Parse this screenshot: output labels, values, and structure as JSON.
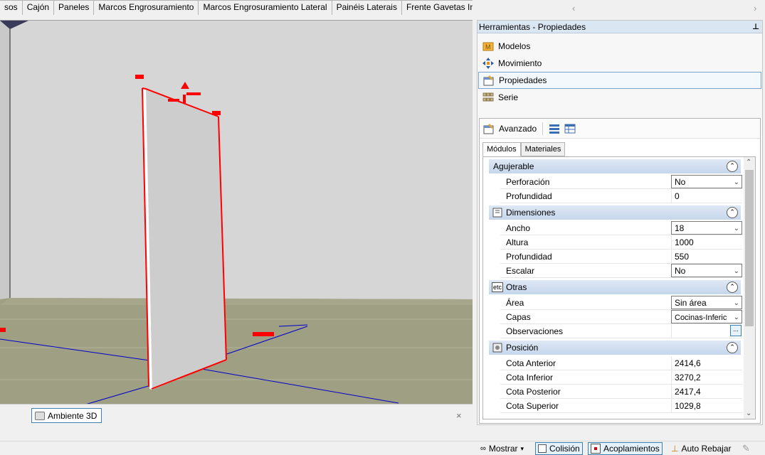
{
  "tabs": [
    "sos",
    "Cajón",
    "Paneles",
    "Marcos Engrosuramiento",
    "Marcos Engrosuramiento Lateral",
    "Painéis Laterais",
    "Frente Gavetas Internas"
  ],
  "tab_scroll": {
    "prev": "‹",
    "next": "›"
  },
  "document_tab": {
    "label": "Ambiente 3D",
    "close": "×"
  },
  "panel": {
    "title": "Herramientas - Propiedades",
    "pin": "🖈",
    "menu": [
      {
        "label": "Modelos",
        "icon": "models-icon"
      },
      {
        "label": "Movimiento",
        "icon": "move-icon"
      },
      {
        "label": "Propiedades",
        "icon": "properties-icon",
        "selected": true
      },
      {
        "label": "Serie",
        "icon": "series-icon"
      }
    ],
    "advanced_label": "Avanzado",
    "subtabs": [
      "Módulos",
      "Materiales"
    ],
    "sections": [
      {
        "title": "Agujerable",
        "rows": [
          {
            "label": "Perforación",
            "value": "No",
            "type": "dropdown"
          },
          {
            "label": "Profundidad",
            "value": "0",
            "type": "text"
          }
        ]
      },
      {
        "title": "Dimensiones",
        "rows": [
          {
            "label": "Ancho",
            "value": "18",
            "type": "dropdown"
          },
          {
            "label": "Altura",
            "value": "1000",
            "type": "more"
          },
          {
            "label": "Profundidad",
            "value": "550",
            "type": "more"
          },
          {
            "label": "Escalar",
            "value": "No",
            "type": "dropdown"
          }
        ]
      },
      {
        "title": "Otras",
        "rows": [
          {
            "label": "Área",
            "value": "Sin área",
            "type": "dropdown"
          },
          {
            "label": "Capas",
            "value": "Cocinas-Inferic",
            "type": "dropdown"
          },
          {
            "label": "Observaciones",
            "value": "",
            "type": "ellipsis"
          }
        ]
      },
      {
        "title": "Posición",
        "rows": [
          {
            "label": "Cota Anterior",
            "value": "2414,6",
            "type": "text"
          },
          {
            "label": "Cota Inferior",
            "value": "3270,2",
            "type": "text"
          },
          {
            "label": "Cota Posterior",
            "value": "2417,4",
            "type": "text"
          },
          {
            "label": "Cota Superior",
            "value": "1029,8",
            "type": "text"
          }
        ]
      }
    ],
    "etc_label": "etc",
    "more_glyph": "»",
    "ellipsis_glyph": "...",
    "collapse_glyph": "⌃"
  },
  "statusbar": {
    "mostrar": "Mostrar",
    "colision": "Colisión",
    "acoplamientos": "Acoplamientos",
    "auto_rebajar": "Auto Rebajar"
  },
  "colors": {
    "accent": "#3c7fb1",
    "section": "#c5d6ec",
    "selection": "#ff0000",
    "axis": "#0000cc"
  }
}
